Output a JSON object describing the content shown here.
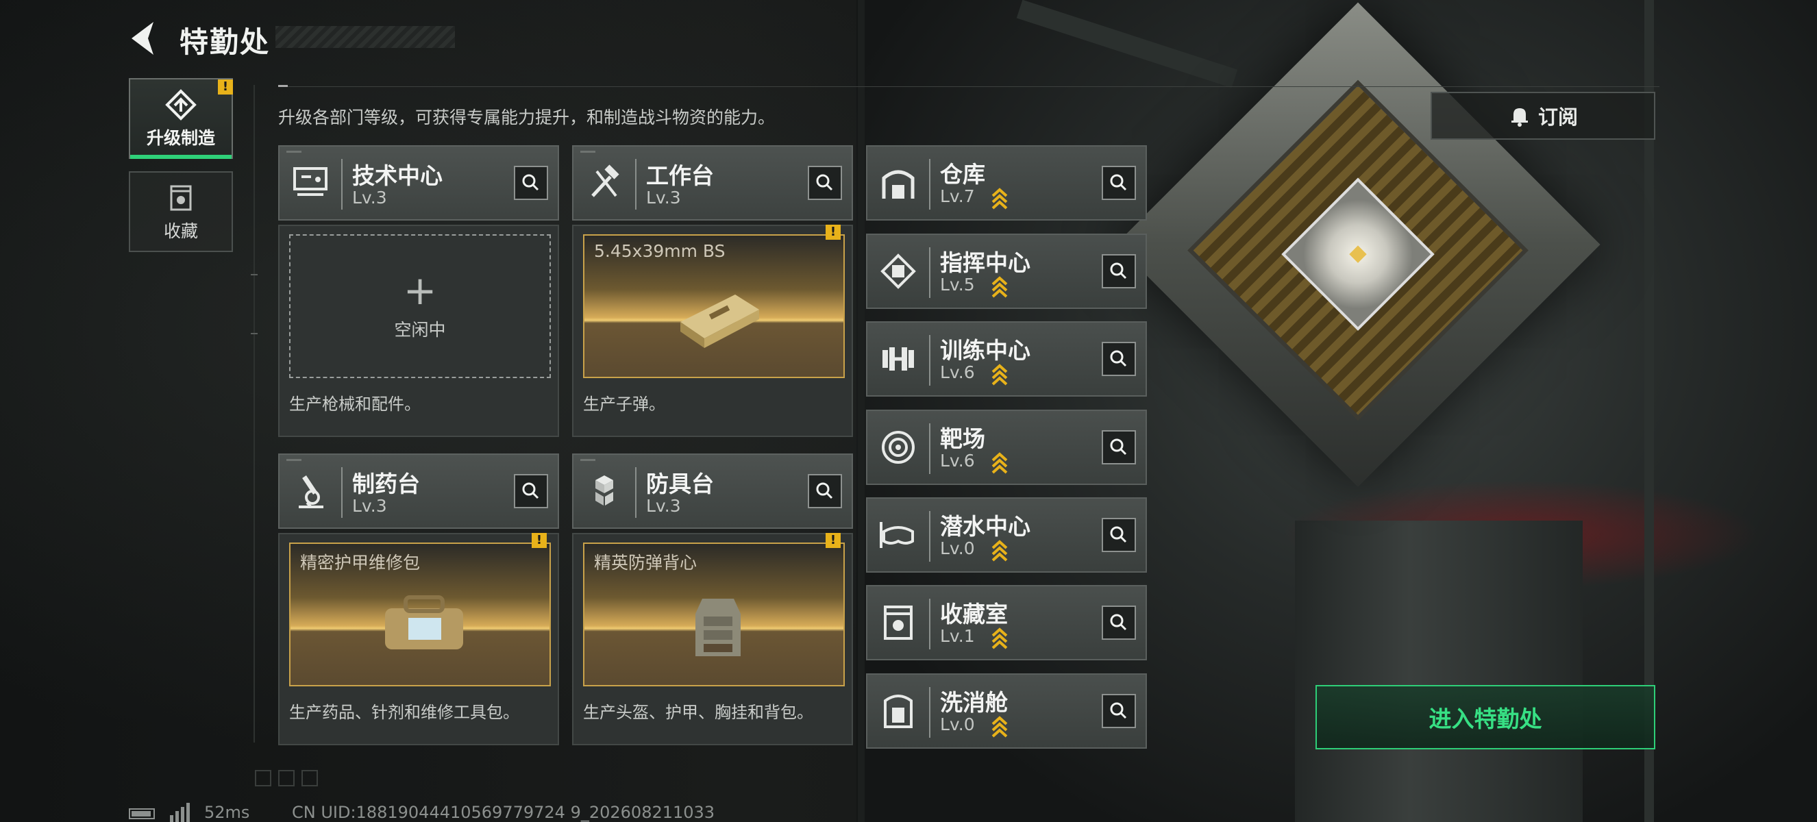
{
  "header": {
    "title": "特勤处"
  },
  "description": "升级各部门等级，可获得专属能力提升，和制造战斗物资的能力。",
  "side_tabs": [
    {
      "label": "升级制造",
      "active": true,
      "badge": "!"
    },
    {
      "label": "收藏",
      "active": false
    }
  ],
  "departments_left": [
    {
      "name": "技术中心",
      "level": "Lv.3",
      "icon": "monitor-icon"
    },
    {
      "name": "工作台",
      "level": "Lv.3",
      "icon": "tools-icon"
    },
    {
      "name": "制药台",
      "level": "Lv.3",
      "icon": "microscope-icon"
    },
    {
      "name": "防具台",
      "level": "Lv.3",
      "icon": "armor-blocks-icon"
    }
  ],
  "production": [
    {
      "status": "idle",
      "idle_plus": "+",
      "idle_text": "空闲中",
      "desc": "生产枪械和配件。"
    },
    {
      "status": "producing",
      "item": "5.45x39mm BS",
      "badge": "!",
      "desc": "生产子弹。"
    },
    {
      "status": "producing",
      "item": "精密护甲维修包",
      "badge": "!",
      "desc": "生产药品、针剂和维修工具包。"
    },
    {
      "status": "producing",
      "item": "精英防弹背心",
      "badge": "!",
      "desc": "生产头盔、护甲、胸挂和背包。"
    }
  ],
  "departments_right": [
    {
      "name": "仓库",
      "level": "Lv.7",
      "upgradable": true,
      "icon": "warehouse-icon"
    },
    {
      "name": "指挥中心",
      "level": "Lv.5",
      "upgradable": true,
      "icon": "chip-icon"
    },
    {
      "name": "训练中心",
      "level": "Lv.6",
      "upgradable": true,
      "icon": "dumbbell-icon"
    },
    {
      "name": "靶场",
      "level": "Lv.6",
      "upgradable": true,
      "icon": "target-icon"
    },
    {
      "name": "潜水中心",
      "level": "Lv.0",
      "upgradable": true,
      "icon": "diving-mask-icon"
    },
    {
      "name": "收藏室",
      "level": "Lv.1",
      "upgradable": true,
      "icon": "collection-icon"
    },
    {
      "name": "洗消舱",
      "level": "Lv.0",
      "upgradable": true,
      "icon": "decon-icon"
    }
  ],
  "subscribe_label": "订阅",
  "enter_label": "进入特勤处",
  "footer": {
    "ping": "52ms",
    "uid": "CN UID:18819044410569779724 9_202608211033"
  },
  "colors": {
    "accent_green": "#2ecf78",
    "warn_yellow": "#e8b21a",
    "gold": "#c9a24a"
  }
}
